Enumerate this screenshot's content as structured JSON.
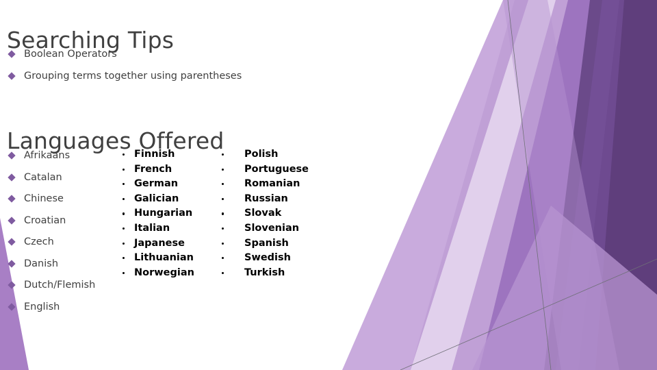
{
  "slide": {
    "background_color": "#ffffff",
    "accent_color": "#7f5ba0",
    "heading_color": "#404040",
    "decor_colors": {
      "light_purple": "#a87fc5",
      "pale_purple": "#c4a5d8",
      "very_pale_purple": "#e2d2ec",
      "mid_purple": "#8f62b4",
      "dark_purple": "#5f3e7c",
      "deep_purple": "#6b4a8a",
      "line_gray": "#6f6f78"
    }
  },
  "sections": {
    "searching_tips": {
      "title": "Searching Tips",
      "bullets": [
        {
          "label": "Boolean Operators"
        },
        {
          "label": "Grouping terms together using parentheses"
        }
      ]
    },
    "languages_offered": {
      "title": "Languages Offered",
      "columns": [
        {
          "style": "diamond",
          "items": [
            {
              "label": "Afrikaans"
            },
            {
              "label": "Catalan"
            },
            {
              "label": "Chinese"
            },
            {
              "label": "Croatian"
            },
            {
              "label": "Czech"
            },
            {
              "label": "Danish"
            },
            {
              "label": "Dutch/Flemish"
            },
            {
              "label": "English"
            }
          ]
        },
        {
          "style": "round",
          "items": [
            {
              "label": "Finnish"
            },
            {
              "label": "French"
            },
            {
              "label": "German"
            },
            {
              "label": "Galician"
            },
            {
              "label": "Hungarian"
            },
            {
              "label": "Italian"
            },
            {
              "label": "Japanese"
            },
            {
              "label": "Lithuanian"
            },
            {
              "label": "Norwegian"
            }
          ]
        },
        {
          "style": "round",
          "items": [
            {
              "label": "Polish"
            },
            {
              "label": "Portuguese"
            },
            {
              "label": "Romanian"
            },
            {
              "label": "Russian"
            },
            {
              "label": "Slovak"
            },
            {
              "label": "Slovenian"
            },
            {
              "label": "Spanish"
            },
            {
              "label": "Swedish"
            },
            {
              "label": "Turkish"
            }
          ]
        }
      ]
    }
  }
}
